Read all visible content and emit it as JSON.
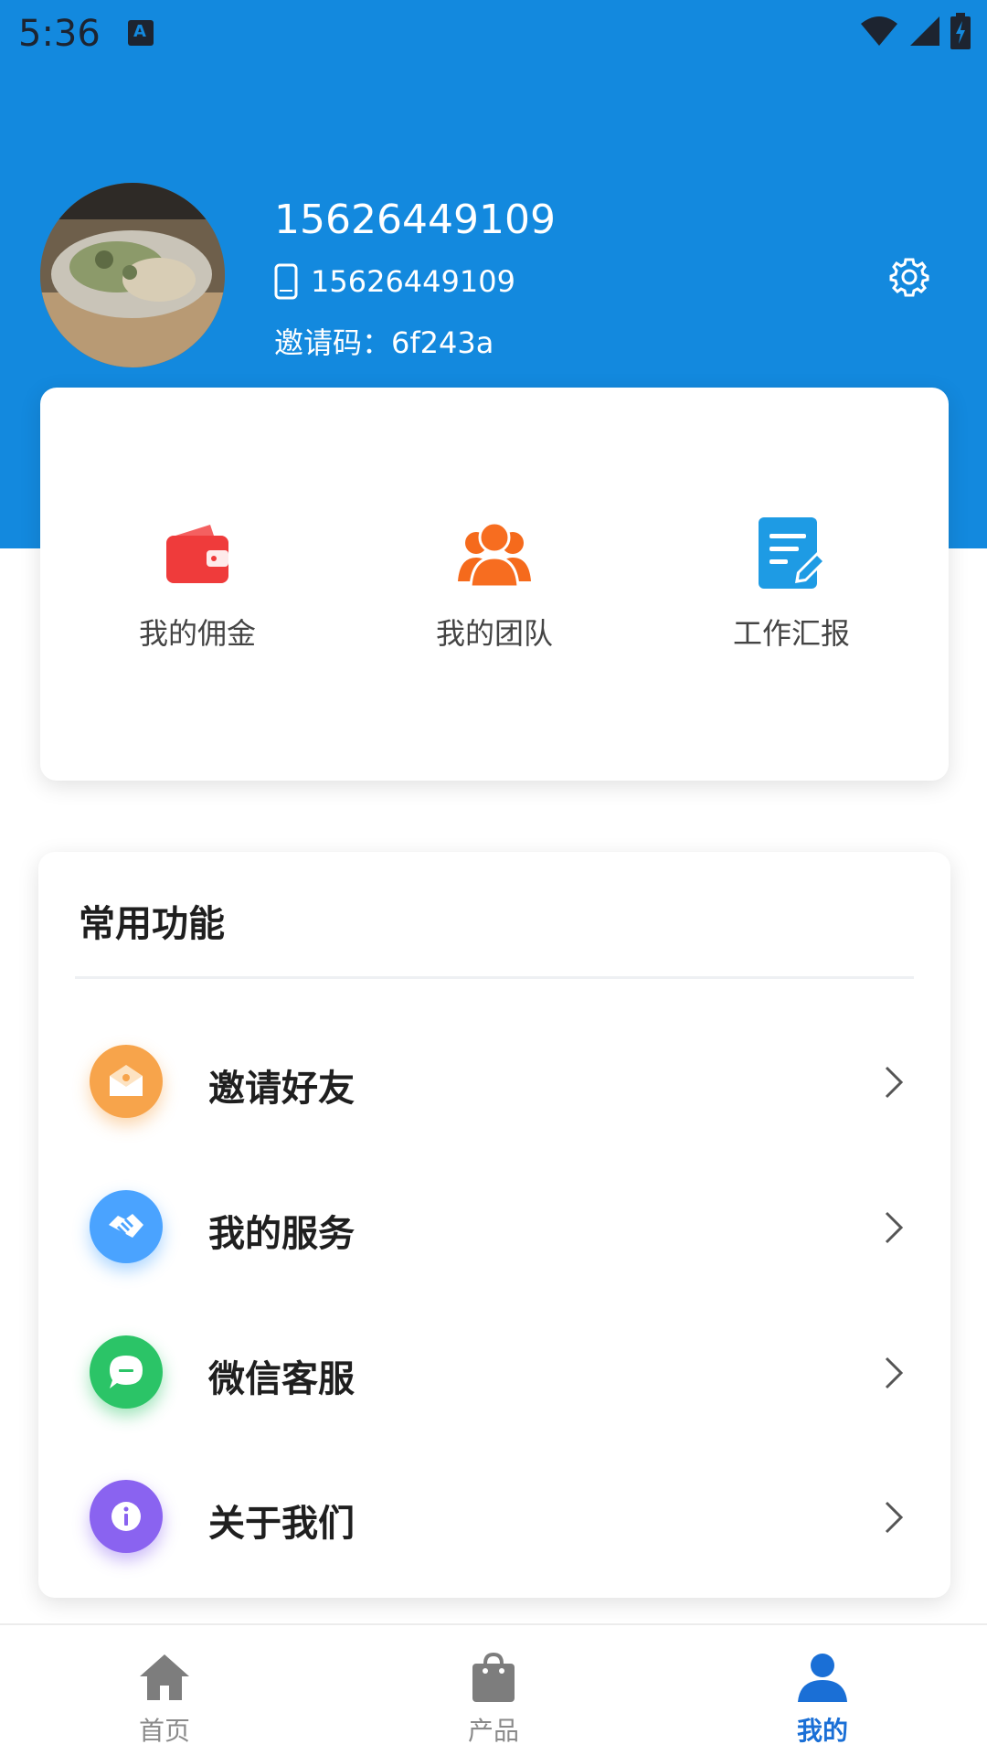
{
  "status_bar": {
    "time": "5:36"
  },
  "profile": {
    "name": "15626449109",
    "phone": "15626449109",
    "invite_code": "邀请码：6f243a"
  },
  "quick_actions": [
    {
      "label": "我的佣金",
      "icon": "wallet-icon",
      "color": "#ef3b3b"
    },
    {
      "label": "我的团队",
      "icon": "team-icon",
      "color": "#f56a1c"
    },
    {
      "label": "工作汇报",
      "icon": "report-edit-icon",
      "color": "#1e9be4"
    }
  ],
  "functions": {
    "title": "常用功能",
    "items": [
      {
        "label": "邀请好友",
        "icon": "envelope-icon",
        "color": "#f7a44b"
      },
      {
        "label": "我的服务",
        "icon": "handshake-icon",
        "color": "#4aa3ff"
      },
      {
        "label": "微信客服",
        "icon": "chat-icon",
        "color": "#2bc467"
      },
      {
        "label": "关于我们",
        "icon": "info-icon",
        "color": "#8a63f0"
      }
    ]
  },
  "tabbar": {
    "items": [
      {
        "label": "首页",
        "icon": "home-icon"
      },
      {
        "label": "产品",
        "icon": "shopping-bag-icon"
      },
      {
        "label": "我的",
        "icon": "user-icon",
        "active": true
      }
    ]
  },
  "colors": {
    "header": "#1389de",
    "accent": "#1a6fd6"
  }
}
